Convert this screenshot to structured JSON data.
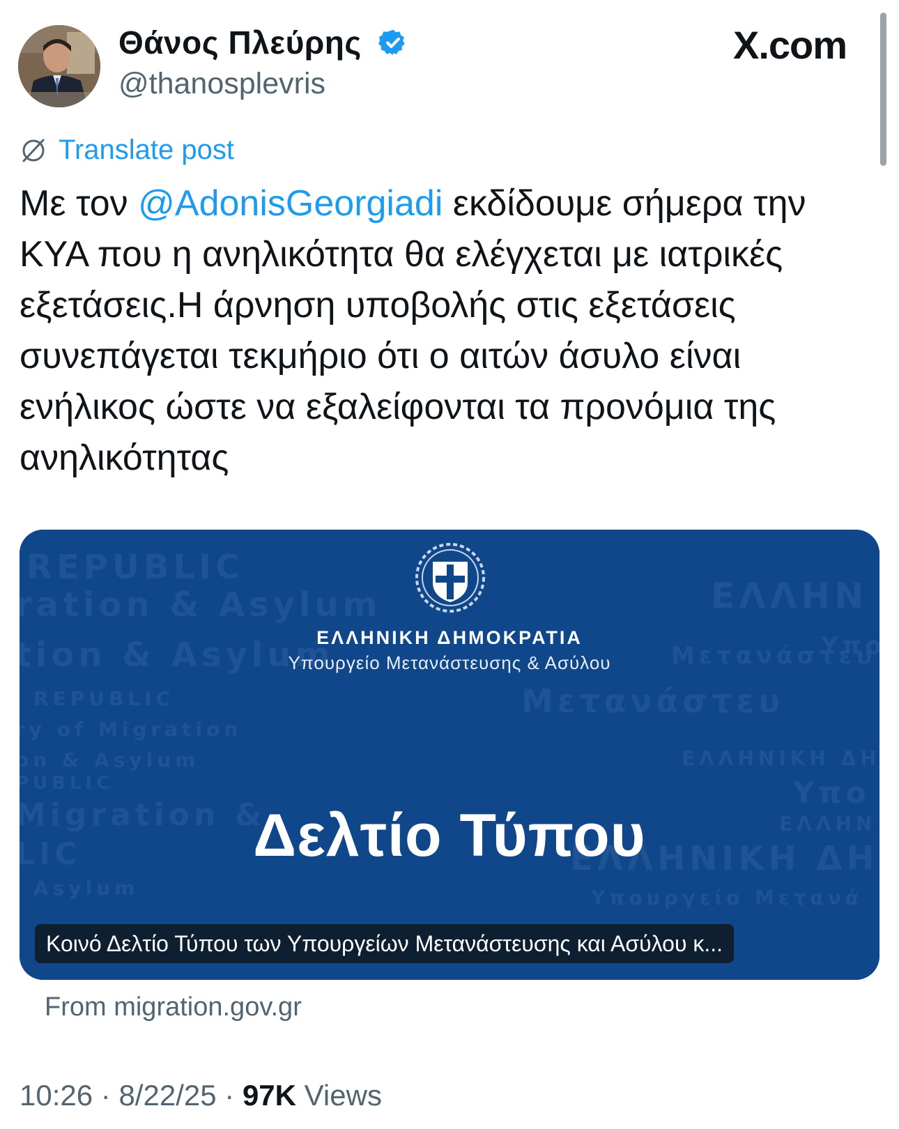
{
  "author": {
    "display_name": "Θάνος Πλεύρης",
    "handle": "@thanosplevris",
    "verified": true,
    "verified_color": "#1d9bf0"
  },
  "site_logo": "X.com",
  "translate_label": "Translate post",
  "tweet": {
    "intro": "Με τον ",
    "mention": "@AdonisGeorgiadi",
    "body": " εκδίδουμε σήμερα την ΚΥΑ που η ανηλικότητα θα ελέγχεται με ιατρικές εξετάσεις.Η άρνηση υποβολής στις εξετάσεις συνεπάγεται τεκμήριο ότι ο αιτών άσυλο είναι ενήλικος ώστε να εξαλείφονται τα προνόμια της ανηλικότητας"
  },
  "link_card": {
    "org": "ΕΛΛΗΝΙΚΗ ΔΗΜΟΚΡΑΤΙΑ",
    "ministry": "Υπουργείο Μετανάστευσης & Ασύλου",
    "title": "Δελτίο Τύπου",
    "caption": "Κοινό Δελτίο Τύπου των Υπουργείων Μετανάστευσης και Ασύλου κ...",
    "background_color": "#10478a",
    "watermark_left": [
      "REPUBLIC",
      "ration & Asylum",
      "tion & Asylum",
      "REPUBLIC",
      "ry of Migration",
      "on & Asylum",
      "PUBLIC",
      "Migration &",
      "LIC",
      "Asylum"
    ],
    "watermark_right": [
      "ΕΛΛΗΝ",
      "Υπο",
      "Μετανάστευ",
      "Μετανάστευ",
      "ΕΛΛΗΝΙΚΗ ΔΗΜ",
      "Υπο",
      "ΕΛΛΗΝ",
      "ΕΛΛΗΝΙΚΗ ΔΗ",
      "Υπουργείο Μετανά"
    ]
  },
  "source": "From migration.gov.gr",
  "meta": {
    "time": "10:26",
    "date": "8/22/25",
    "views_count": "97K",
    "views_label": "Views",
    "separator": "·"
  }
}
